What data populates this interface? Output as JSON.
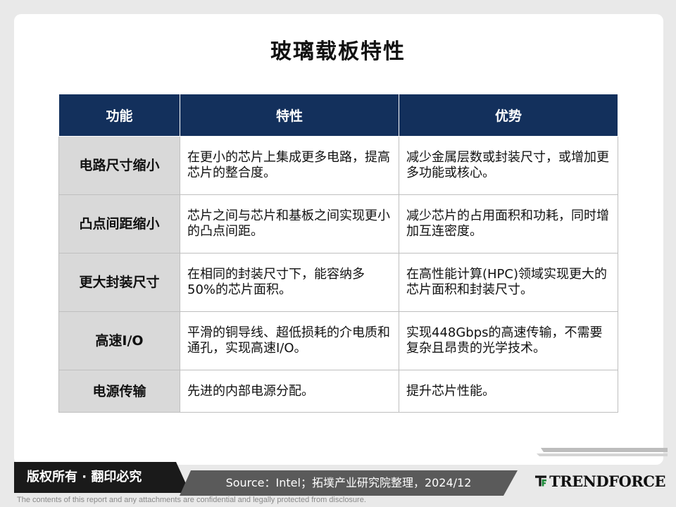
{
  "title": "玻璃载板特性",
  "table": {
    "headers": [
      "功能",
      "特性",
      "优势"
    ],
    "rows": [
      {
        "function": "电路尺寸缩小",
        "feature": "在更小的芯片上集成更多电路，提高芯片的整合度。",
        "advantage": "减少金属层数或封装尺寸，或增加更多功能或核心。"
      },
      {
        "function": "凸点间距缩小",
        "feature": "芯片之间与芯片和基板之间实现更小的凸点间距。",
        "advantage": "减少芯片的占用面积和功耗，同时增加互连密度。"
      },
      {
        "function": "更大封装尺寸",
        "feature": "在相同的封装尺寸下，能容纳多50%的芯片面积。",
        "advantage": "在高性能计算(HPC)领域实现更大的芯片面积和封装尺寸。"
      },
      {
        "function": "高速I/O",
        "feature": "平滑的铜导线、超低损耗的介电质和通孔，实现高速I/O。",
        "advantage": "实现448Gbps的高速传输，不需要复杂且昂贵的光学技术。"
      },
      {
        "function": "电源传输",
        "feature": "先进的内部电源分配。",
        "advantage": "提升芯片性能。"
      }
    ]
  },
  "footer": {
    "copyright": "版权所有 · 翻印必究",
    "source": "Source：Intel；拓墣产业研究院整理，2024/12",
    "brand": "TRENDFORCE",
    "disclaimer": "The contents of this report and any attachments are confidential and legally protected from disclosure."
  },
  "colors": {
    "header_bg": "#13305c",
    "function_cell_bg": "#d9d9d9",
    "badge_bg": "#1a1a1a",
    "source_bg": "#5a5a5a",
    "brand_green": "#1e8a3a"
  },
  "icons": {
    "brand_logo": "trendforce-logo-icon"
  }
}
